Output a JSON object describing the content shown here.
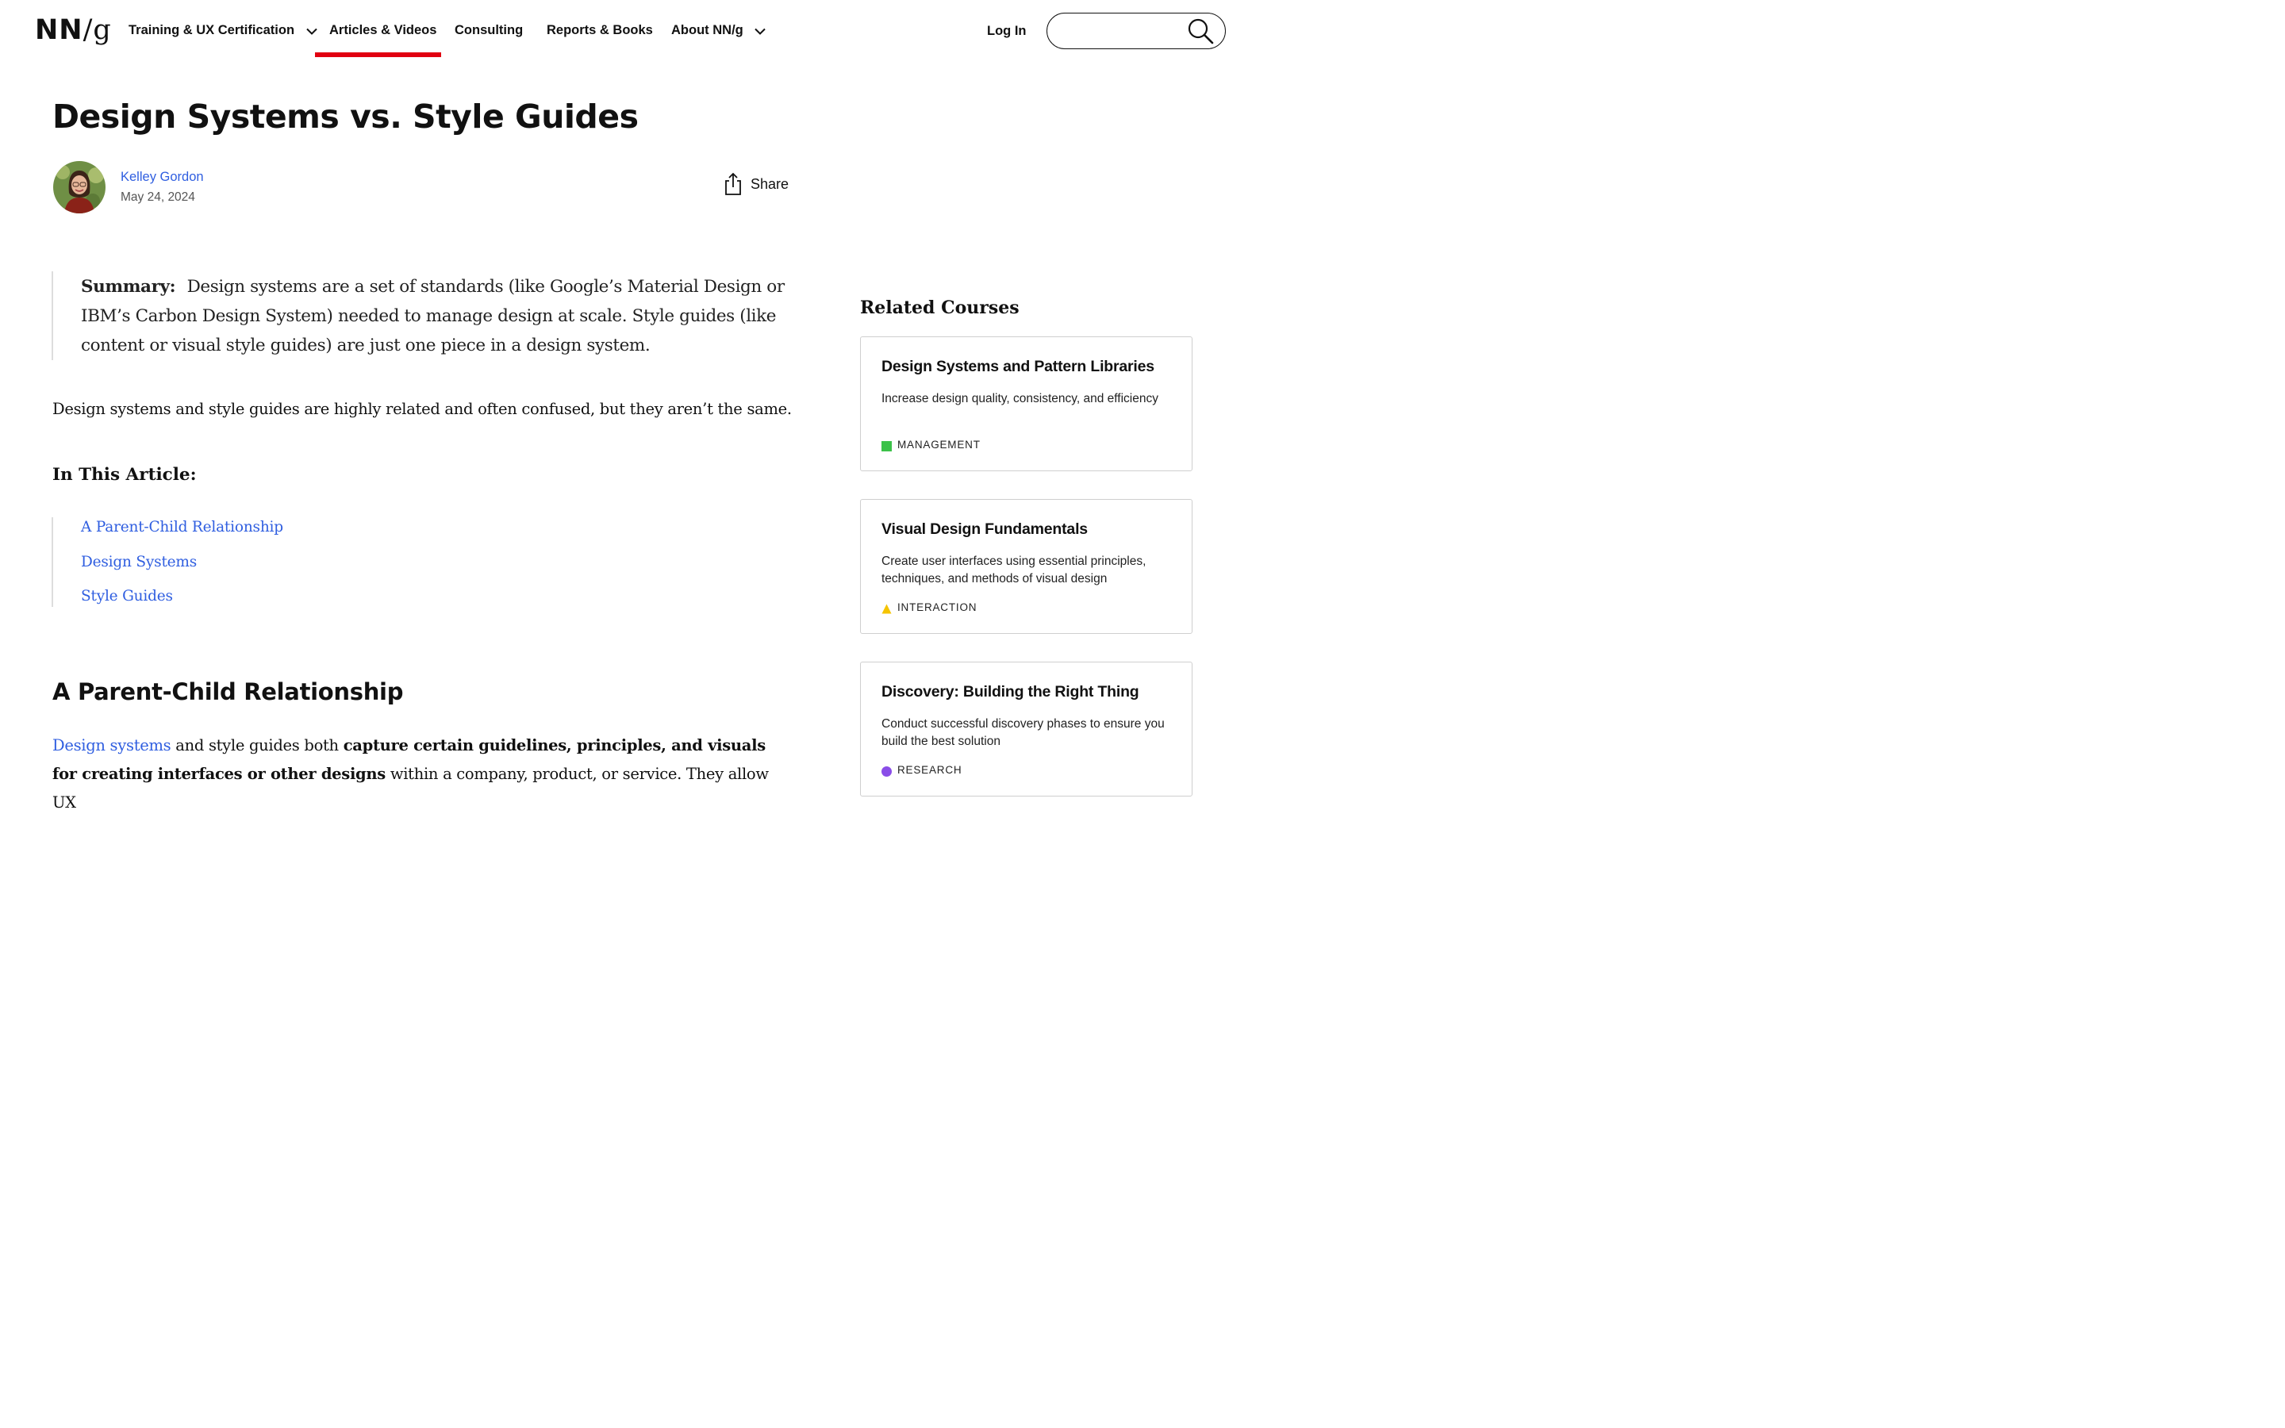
{
  "logo": {
    "text_a": "NN",
    "text_b": "/",
    "text_c": "g"
  },
  "nav": {
    "items": [
      {
        "label": "Training & UX Certification"
      },
      {
        "label": "Articles & Videos"
      },
      {
        "label": "Consulting"
      },
      {
        "label": "Reports & Books"
      },
      {
        "label": "About NN/g"
      }
    ],
    "active_color": "#e10011",
    "login": "Log In",
    "search_placeholder": ""
  },
  "article": {
    "title": "Design Systems vs. Style Guides",
    "author": "Kelley Gordon",
    "date": "May 24, 2024",
    "share": "Share",
    "summary_label": "Summary:",
    "summary_text": "Design systems are a set of standards (like Google’s Material Design or IBM’s Carbon Design System) needed to manage design at scale. Style guides (like content or visual style guides) are just one piece in a design system.",
    "intro": "Design systems and style guides are highly related and often confused, but they aren’t the same.",
    "toc_heading": "In This Article:",
    "toc": [
      {
        "label": "A Parent-Child Relationship"
      },
      {
        "label": "Design Systems"
      },
      {
        "label": "Style Guides"
      }
    ],
    "section_heading": "A Parent-Child Relationship",
    "para_link": "Design systems",
    "para_text1": " and style guides both ",
    "para_bold": "capture certain guidelines, principles, and visuals for creating interfaces or other designs",
    "para_text2": " within a company, product, or service. They allow UX",
    "link_color": "#2f5ee0"
  },
  "sidebar": {
    "heading": "Related Courses",
    "courses": [
      {
        "title": "Design Systems and Pattern Libraries",
        "description": "Increase design quality, consistency, and efficiency",
        "tag": "MANAGEMENT",
        "tag_color": "#3cc24a",
        "tag_shape": "square"
      },
      {
        "title": "Visual Design Fundamentals",
        "description": "Create user interfaces using essential principles, techniques, and methods of visual design",
        "tag": "INTERACTION",
        "tag_color": "#f5c400",
        "tag_shape": "triangle"
      },
      {
        "title": "Discovery: Building the Right Thing",
        "description": "Conduct successful discovery phases to ensure you build the best solution",
        "tag": "RESEARCH",
        "tag_color": "#8a4de8",
        "tag_shape": "circle"
      }
    ]
  }
}
